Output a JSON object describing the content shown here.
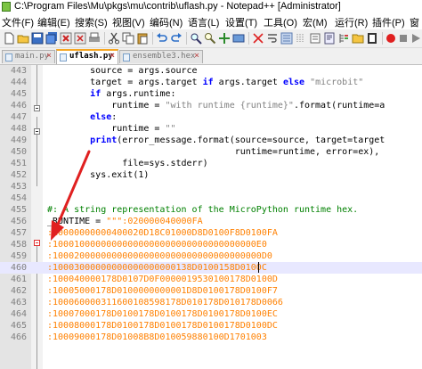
{
  "window": {
    "title": "C:\\Program Files\\Mu\\pkgs\\mu\\contrib\\uflash.py - Notepad++ [Administrator]"
  },
  "menu": [
    "文件(F)",
    "编辑(E)",
    "搜索(S)",
    "视图(V)",
    "编码(N)",
    "语言(L)",
    "设置(T)",
    "工具(O)",
    "宏(M)",
    "运行(R)",
    "插件(P)",
    "窗"
  ],
  "toolbar": {
    "icons": [
      "new-file-icon",
      "open-file-icon",
      "save-icon",
      "save-all-icon",
      "close-icon",
      "close-all-icon",
      "print-icon",
      "cut-icon",
      "copy-icon",
      "paste-icon",
      "undo-icon",
      "redo-icon",
      "find-icon",
      "replace-icon",
      "zoom-in-icon",
      "zoom-out-icon",
      "sync-icon",
      "wrap-icon",
      "all-chars-icon",
      "indent-guide-icon",
      "lang-icon",
      "doc-map-icon",
      "function-list-icon",
      "folder-icon",
      "monitor-icon",
      "record-icon",
      "stop-icon",
      "play-icon"
    ]
  },
  "tabs": [
    {
      "label": "main.py",
      "active": false
    },
    {
      "label": "uflash.py",
      "active": true
    },
    {
      "label": "ensemble3.hex",
      "active": false
    }
  ],
  "editor": {
    "lines": [
      {
        "num": "443",
        "text": "        source = args.source"
      },
      {
        "num": "444",
        "text": "        target = args.target if args.target else \"microbit\""
      },
      {
        "num": "445",
        "text": "        if args.runtime:"
      },
      {
        "num": "446",
        "text": "            runtime = \"with runtime {runtime}\".format(runtime=a"
      },
      {
        "num": "447",
        "text": "        else:"
      },
      {
        "num": "448",
        "text": "            runtime = \"\""
      },
      {
        "num": "449",
        "text": "        print(error_message.format(source=source, target=target"
      },
      {
        "num": "450",
        "text": "                                   runtime=runtime, error=ex),"
      },
      {
        "num": "451",
        "text": "              file=sys.stderr)"
      },
      {
        "num": "452",
        "text": "        sys.exit(1)"
      },
      {
        "num": "453",
        "text": ""
      },
      {
        "num": "454",
        "text": ""
      },
      {
        "num": "455",
        "text": "#: A string representation of the MicroPython runtime hex."
      },
      {
        "num": "456",
        "text": "_RUNTIME = \"\"\":020000040000FA"
      },
      {
        "num": "457",
        "text": ":10000000000400020D18C01000D8D0100F8D0100FA"
      },
      {
        "num": "458",
        "text": ":10001000000000000000000000000000000000E0"
      },
      {
        "num": "459",
        "text": ":100020000000000000000000000000000000000D0"
      },
      {
        "num": "460",
        "text": ":10003000000000000000000138D0100158D0100C"
      },
      {
        "num": "461",
        "text": ":100040000178D0107D0F0000019530100178D0100D"
      },
      {
        "num": "462",
        "text": ":10005000178D0100000000001D8D0100178D0100F7"
      },
      {
        "num": "463",
        "text": ":100060000311600108598178D010178D010178D0066"
      },
      {
        "num": "464",
        "text": ":10007000178D0100178D0100178D0100178D0100EC"
      },
      {
        "num": "465",
        "text": ":10008000178D0100178D0100178D0100178D0100DC"
      },
      {
        "num": "466",
        "text": ":10009000178D01008B8D010059880100D1701003"
      }
    ]
  }
}
